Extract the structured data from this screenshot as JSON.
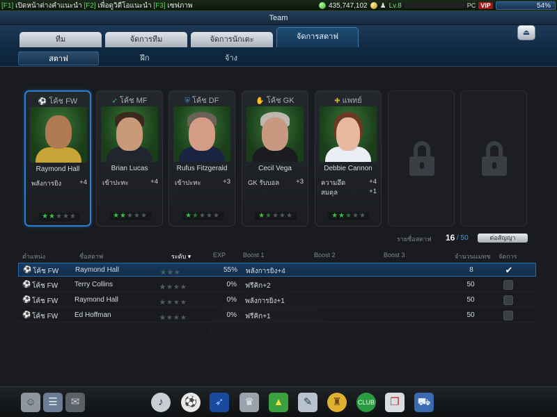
{
  "topbar": {
    "help_text": "[F1] เปิดหน้าต่างคำแนะนำ [F2] เพื่อดูวิดีโอแนะนำ [F3] เซฟภาพ",
    "k1": "[F1]",
    "t1": " เปิดหน้าต่างคำแนะนำ ",
    "k2": "[F2]",
    "t2": " เพื่อดูวิดีโอแนะนำ ",
    "k3": "[F3]",
    "t3": " เซฟภาพ",
    "money": "435,747,102",
    "level": "Lv.8",
    "pc_label": "PC",
    "vip_label": "VIP",
    "progress_text": "54%",
    "progress": 0.54
  },
  "window": {
    "title": "Team"
  },
  "tabs": [
    {
      "label": "ทีม",
      "active": false
    },
    {
      "label": "จัดการทีม",
      "active": false
    },
    {
      "label": "จัดการนักเตะ",
      "active": false
    },
    {
      "label": "จัดการสตาฟ",
      "active": true
    }
  ],
  "subtabs": [
    {
      "label": "สตาฟ",
      "active": true
    },
    {
      "label": "ฝึก",
      "active": false
    },
    {
      "label": "จ้าง",
      "active": false
    }
  ],
  "cards": [
    {
      "role": "โค้ช FW",
      "icon": "ball-icon",
      "name": "Raymond Hall",
      "stats": [
        {
          "label": "พลังการยิง",
          "value": "+4"
        }
      ],
      "stars": 2
    },
    {
      "role": "โค้ช MF",
      "icon": "boot-icon",
      "name": "Brian Lucas",
      "stats": [
        {
          "label": "เข้าปะทะ",
          "value": "+4"
        }
      ],
      "stars": 2
    },
    {
      "role": "โค้ช DF",
      "icon": "shield-icon",
      "name": "Rufus Fitzgerald",
      "stats": [
        {
          "label": "เข้าปะทะ",
          "value": "+3"
        }
      ],
      "stars": 1.5
    },
    {
      "role": "โค้ช GK",
      "icon": "glove-icon",
      "name": "Cecil Vega",
      "stats": [
        {
          "label": "GK รับบอล",
          "value": "+3"
        }
      ],
      "stars": 1.5
    },
    {
      "role": "แพทย์",
      "icon": "medkit-icon",
      "name": "Debbie Cannon",
      "stats": [
        {
          "label": "ความอึด",
          "value": "+4"
        },
        {
          "label": "สมดุล",
          "value": "+1"
        }
      ],
      "stars": 2.5
    }
  ],
  "staff_summary": {
    "label": "รายชื่อสตาฟ",
    "count": "16",
    "max": "/ 50",
    "contract_button": "ต่อสัญญา"
  },
  "table": {
    "headers": {
      "position": "ตำแหน่ง",
      "name": "ชื่อสตาฟ",
      "level": "ระดับ ▾",
      "exp": "EXP",
      "boost1": "Boost 1",
      "boost2": "Boost 2",
      "boost3": "Boost 3",
      "matches": "จำนวนแมทช",
      "manage": "จัดการ"
    },
    "rows": [
      {
        "position": "โค้ช FW",
        "name": "Raymond Hall",
        "stars": 2,
        "exp": "55%",
        "boost1": "พลังการยิง+4",
        "matches": "8",
        "checked": true
      },
      {
        "position": "โค้ช FW",
        "name": "Terry Collins",
        "stars": 1,
        "exp": "0%",
        "boost1": "ฟรีคิก+2",
        "matches": "50",
        "checked": false
      },
      {
        "position": "โค้ช FW",
        "name": "Raymond Hall",
        "stars": 1,
        "exp": "0%",
        "boost1": "พลังการยิง+1",
        "matches": "50",
        "checked": false
      },
      {
        "position": "โค้ช FW",
        "name": "Ed Hoffman",
        "stars": 1,
        "exp": "0%",
        "boost1": "ฟรีคิก+1",
        "matches": "50",
        "checked": false
      }
    ]
  },
  "bottom_icons": [
    "profile-icon",
    "list-icon",
    "mail-icon",
    "whistle-icon",
    "ball-icon",
    "boot-icon",
    "trophy-icon",
    "ranking-icon",
    "notepad-icon",
    "jersey-icon",
    "club-icon",
    "card-icon",
    "cart-icon"
  ]
}
